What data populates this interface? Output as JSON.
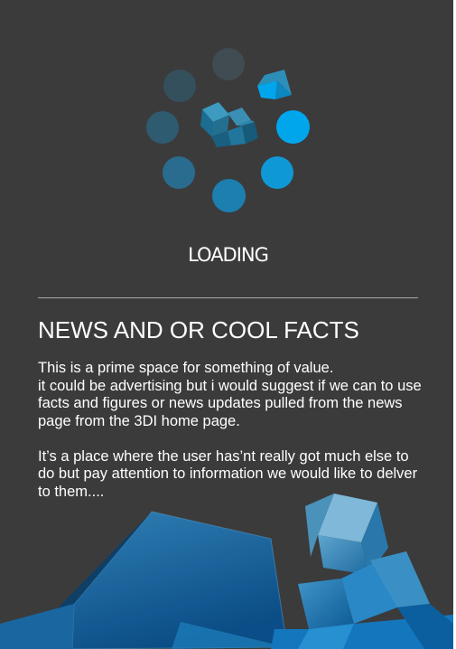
{
  "loading": {
    "label": "LOADING",
    "colors": {
      "accent": "#00a6ec",
      "dot_medium": "#2286b5",
      "dot_dim": "#2a5f79",
      "dot_faint": "#355361",
      "dot_ghost": "#404b52"
    }
  },
  "news": {
    "heading": "NEWS AND OR COOL FACTS",
    "paragraphs": [
      "This is a prime space for something of value.\nit could be advertising but i would suggest if we can to use facts and figures or news updates pulled from the news page from the 3DI home page.",
      "It’s a place where the user has’nt really got much else to do but pay attention to information we would like to delver to them...."
    ]
  },
  "theme": {
    "background": "#3b3b3c",
    "text": "#ffffff",
    "divider": "#a9a9aa"
  }
}
